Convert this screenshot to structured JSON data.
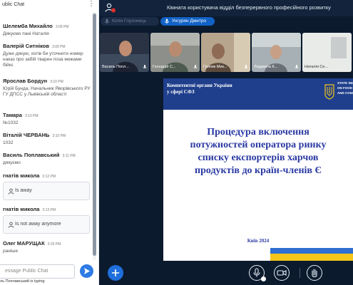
{
  "chat": {
    "title": "ublic Chat",
    "messages": [
      {
        "name": "Шелемба Михайло",
        "time": "3:09 PM",
        "text": "Дякуємо пані Наталія"
      },
      {
        "name": "Валерій Ситніков",
        "time": "3:09 PM",
        "text": "Дуже дякую, хотів би уточнити номер наказ про забій тварин поза межами бійні."
      },
      {
        "name": "Ярослав Бордун",
        "time": "3:10 PM",
        "text": "Юрій Бунда, Начальник Яворівського РУ ГУ ДПСС у Львівській області"
      },
      {
        "name": "Тамара",
        "time": "3:10 PM",
        "text": "№1032"
      },
      {
        "name": "Віталій ЧЕРВАНЬ",
        "time": "3:10 PM",
        "text": "1032"
      },
      {
        "name": "Василь Поплавський",
        "time": "3:11 PM",
        "text": "дякуємо"
      },
      {
        "name": "гнатів микола",
        "time": "3:12 PM",
        "text": "",
        "status": "Is away"
      },
      {
        "name": "гнатів микола",
        "time": "3:13 PM",
        "text": "",
        "status": "Is not away anymore"
      },
      {
        "name": "Олег МАРУЩАК",
        "time": "3:20 PM",
        "text": "раніше"
      }
    ],
    "input_placeholder": "essage Public Chat",
    "typing": "ль Поплавський is typing"
  },
  "meeting": {
    "room_title": "Кімната користувача відділ безперервного професійного розвитку",
    "talking": [
      {
        "name": "Юлія Глухонець",
        "active": false
      },
      {
        "name": "Унгурян Дмитро",
        "active": true
      }
    ],
    "participants": [
      {
        "label": "Василь Попл..."
      },
      {
        "label": "Геннадій С..."
      },
      {
        "label": "Грипик Мик..."
      },
      {
        "label": "Людмила К..."
      },
      {
        "label": "Наталія Се..."
      }
    ]
  },
  "slide": {
    "org_line1": "Компетентні органи України",
    "org_line2": "у сфері СФЗ",
    "state_text": "STATE SERVICE ON FOOD SAFETY AND CONSUMER",
    "title_lines": [
      "Процедура включення",
      "потужностей оператора ринку",
      "списку експортерів харчов",
      "продуктів до країн-членів Є"
    ],
    "footer": "Київ 2024"
  },
  "colors": {
    "accent": "#2d7be5",
    "meeting_bg": "#0c1a2e",
    "slide_band": "#1f3f8c",
    "slide_title": "#2b3aa3",
    "flag_blue": "#2f6fd0",
    "flag_yellow": "#f5c518"
  }
}
